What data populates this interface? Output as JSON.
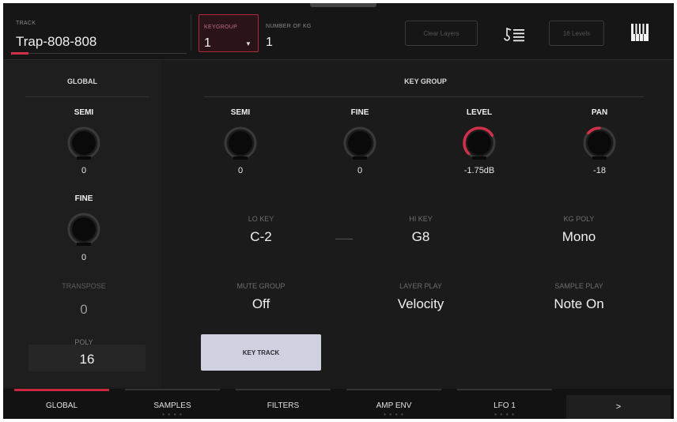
{
  "colors": {
    "accent": "#c8283e",
    "panel": "#1b1b1b",
    "knob_ring": "#d0304a"
  },
  "header": {
    "track_label": "TRACK",
    "track_name": "Trap-808-808",
    "keygroup_label": "KEYGROUP",
    "keygroup_value": "1",
    "num_kg_label": "NUMBER OF KG",
    "num_kg_value": "1",
    "clear_label": "Clear Layers",
    "pad_label": "16 Levels",
    "tracklist_icon": "note-list-icon",
    "keys_icon": "piano-keys-icon"
  },
  "global": {
    "title": "GLOBAL",
    "semi": {
      "label": "SEMI",
      "value": "0",
      "level": 0
    },
    "fine": {
      "label": "FINE",
      "value": "0",
      "level": 0
    },
    "transpose": {
      "label": "TRANSPOSE",
      "value": "0"
    },
    "poly": {
      "label": "POLY",
      "value": "16"
    }
  },
  "keygroup": {
    "title": "KEY GROUP",
    "semi": {
      "label": "SEMI",
      "value": "0",
      "level": 0
    },
    "fine": {
      "label": "FINE",
      "value": "0",
      "level": 0
    },
    "level": {
      "label": "LEVEL",
      "value": "-1.75dB",
      "level": 0.72
    },
    "pan": {
      "label": "PAN",
      "value": "-18",
      "level": -0.18
    },
    "lo_key": {
      "label": "LO KEY",
      "value": "C-2"
    },
    "hi_key": {
      "label": "HI KEY",
      "value": "G8"
    },
    "kg_poly": {
      "label": "KG POLY",
      "value": "Mono"
    },
    "mute_group": {
      "label": "MUTE GROUP",
      "value": "Off"
    },
    "layer_play": {
      "label": "LAYER PLAY",
      "value": "Velocity"
    },
    "sample_play": {
      "label": "SAMPLE PLAY",
      "value": "Note On"
    },
    "key_track_label": "KEY TRACK"
  },
  "tabs": [
    {
      "label": "GLOBAL",
      "active": true
    },
    {
      "label": "SAMPLES",
      "active": false
    },
    {
      "label": "FILTERS",
      "active": false
    },
    {
      "label": "AMP ENV",
      "active": false
    },
    {
      "label": "LFO 1",
      "active": false
    }
  ],
  "more_label": ">"
}
